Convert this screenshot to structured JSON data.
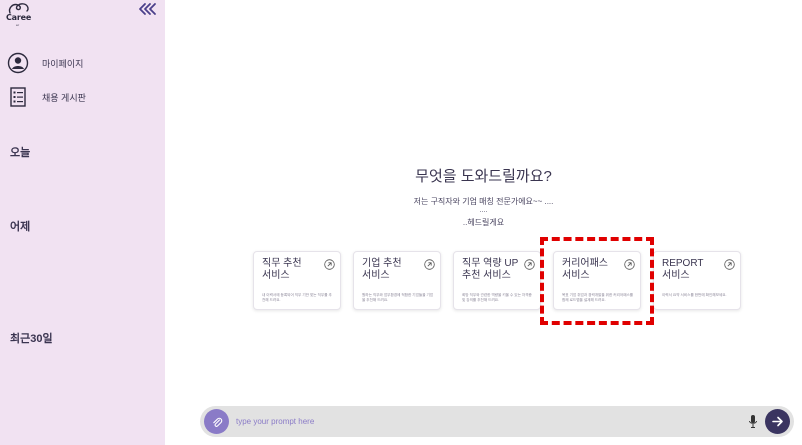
{
  "brand": {
    "logo_text": "Caree",
    "logo_sub": "er",
    "color": "#2d2a3e"
  },
  "sidebar": {
    "background": "#f1e2f2",
    "items": [
      {
        "label": "마이페이지",
        "icon": "user-circle-icon"
      },
      {
        "label": "채용 게시판",
        "icon": "list-board-icon"
      }
    ],
    "sections": [
      {
        "label": "오늘"
      },
      {
        "label": "어제"
      },
      {
        "label": "최근30일"
      }
    ]
  },
  "main": {
    "headline": "무엇을 도와드릴까요?",
    "subtitle_1": "저는 구직자와 기업 매칭 전문가에요~~ ....",
    "subtitle_2": "....",
    "subtitle_3": "..헤드릴게요",
    "cards": [
      {
        "title": "직무 추천\n서비스",
        "desc": "내 이력서에 등록되어 직무 기반 맞는 직무를 추천해 드려요.",
        "icon": "arrow-up-right-icon"
      },
      {
        "title": "기업 추천\n서비스",
        "desc": "원하는 직무와 업무환경에 적합한 기업들을 기업을 추천해 드려요.",
        "icon": "arrow-up-right-icon"
      },
      {
        "title": "직무 역량 UP\n추천 서비스",
        "desc": "희망 직무와 관련한 역량을 키울 수 있는 자격증 및 강의를 추천해 드려요.",
        "icon": "arrow-up-right-icon"
      },
      {
        "title": "커리어패스\n서비스",
        "desc": "목표 기업 취업과 경력개발을 위한 커리어패스를 함께 로드맵을 설계해 드려요.",
        "icon": "arrow-up-right-icon"
      },
      {
        "title": "REPORT\n서비스",
        "desc": "이력서 요약 서비스를 한번에 확인해보세요.",
        "icon": "arrow-up-right-icon"
      }
    ],
    "highlight_color": "#e00000"
  },
  "prompt": {
    "placeholder": "type your prompt here",
    "value": "",
    "attach_icon": "paperclip-icon",
    "mic_icon": "microphone-icon",
    "send_icon": "arrow-right-icon",
    "accent": "#8a7bc7",
    "send_color": "#3a3460"
  }
}
